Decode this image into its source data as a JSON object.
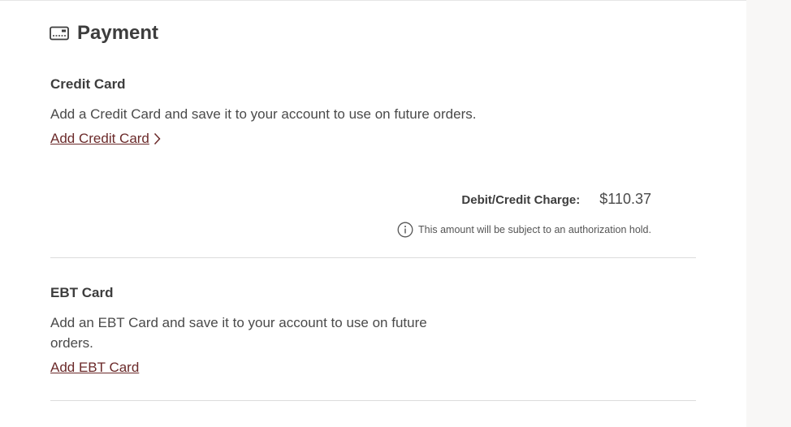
{
  "payment": {
    "title": "Payment",
    "title_icon": "credit-card-icon"
  },
  "credit_card": {
    "heading": "Credit Card",
    "description": "Add a Credit Card and save it to your account to use on future orders.",
    "add_link": "Add Credit Card",
    "link_icon": "chevron-right-icon"
  },
  "charge": {
    "label": "Debit/Credit Charge:",
    "amount": "$110.37",
    "hold_notice": "This amount will be subject to an authorization hold.",
    "notice_icon": "info-icon"
  },
  "ebt_card": {
    "heading": "EBT Card",
    "description_line1": "Add an EBT Card and save it to your account to use on future",
    "description_line2": "orders.",
    "add_link": "Add EBT Card"
  },
  "colors": {
    "link": "#6b2a2a",
    "text": "#404040",
    "divider": "#dcdcdc",
    "panel_bg": "#ffffff",
    "page_bg": "#f8f7f6"
  }
}
